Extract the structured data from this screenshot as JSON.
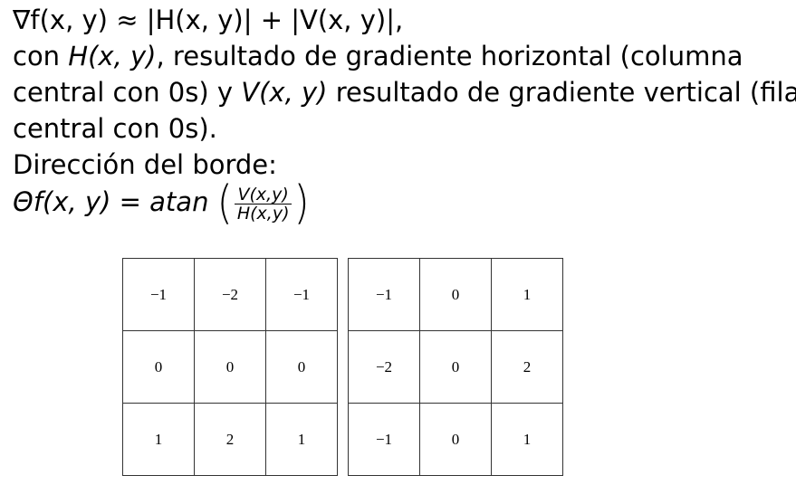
{
  "text": {
    "formula_gradient": "∇f(x, y) ≈ |H(x, y)| + |V(x, y)|,",
    "line1_prefix": "con ",
    "line1_math": "H(x, y)",
    "line1_rest": ", resultado de gradiente horizontal (columna",
    "line2_prefix": "central con 0s) y ",
    "line2_math": "V(x, y)",
    "line2_rest": " resultado de gradiente vertical (fila",
    "line3": "central con 0s).",
    "direction_label": "Dirección del borde:",
    "theta_lhs": "Θf(x, y) = atan",
    "frac_num": "V(x,y)",
    "frac_den": "H(x,y)"
  },
  "kernels": {
    "horizontal": [
      [
        "−1",
        "−2",
        "−1"
      ],
      [
        "0",
        "0",
        "0"
      ],
      [
        "1",
        "2",
        "1"
      ]
    ],
    "vertical": [
      [
        "−1",
        "0",
        "1"
      ],
      [
        "−2",
        "0",
        "2"
      ],
      [
        "−1",
        "0",
        "1"
      ]
    ]
  }
}
